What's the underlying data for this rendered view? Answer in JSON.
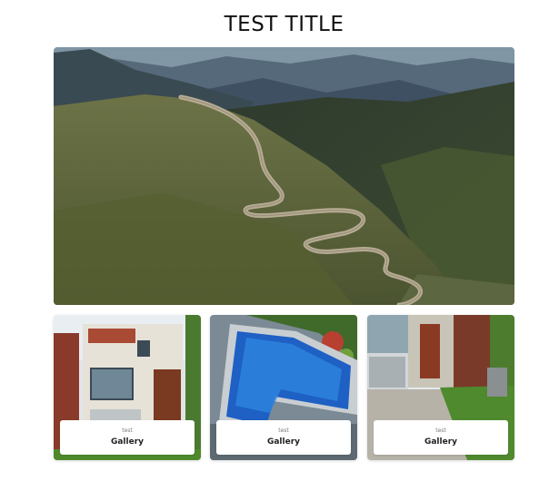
{
  "page": {
    "title": "TEST TITLE"
  },
  "hero": {
    "image": "mountain-road-image"
  },
  "gallery": {
    "cards": [
      {
        "subtitle": "test",
        "label": "Gallery",
        "image": "modern-house-image"
      },
      {
        "subtitle": "test",
        "label": "Gallery",
        "image": "swimming-pool-image"
      },
      {
        "subtitle": "test",
        "label": "Gallery",
        "image": "house-garage-image"
      }
    ]
  }
}
